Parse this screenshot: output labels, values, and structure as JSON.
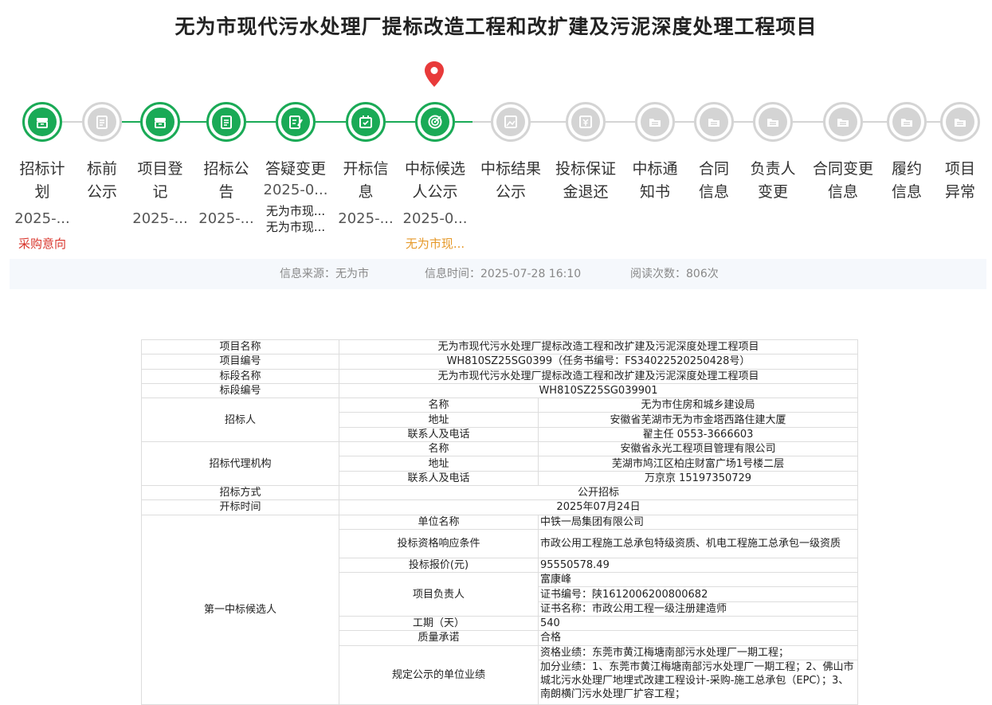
{
  "page_title": "无为市现代污水处理厂提标改造工程和改扩建及污泥深度处理工程项目",
  "colors": {
    "done": "#1aaa56",
    "pending": "#d4d4d4",
    "pin": "#e83a3a",
    "red_note": "#d9342b",
    "orange_note": "#e69a2b"
  },
  "steps": [
    {
      "l1": "招标计",
      "l2": "划",
      "date": "2025-...",
      "note": "采购意向",
      "state": "done"
    },
    {
      "l1": "标前",
      "l2": "公示",
      "state": "pending"
    },
    {
      "l1": "项目登",
      "l2": "记",
      "date": "2025-...",
      "state": "done"
    },
    {
      "l1": "招标公",
      "l2": "告",
      "date": "2025-...",
      "state": "done"
    },
    {
      "l1": "答疑变更",
      "l2": "",
      "date": "2025-0...",
      "sub1": "无为市现...",
      "sub2": "无为市现...",
      "state": "done"
    },
    {
      "l1": "开标信",
      "l2": "息",
      "date": "2025-...",
      "state": "done"
    },
    {
      "l1": "中标候选",
      "l2": "人公示",
      "date": "2025-0...",
      "note": "无为市现...",
      "state": "current"
    },
    {
      "l1": "中标结果",
      "l2": "公示",
      "state": "pending"
    },
    {
      "l1": "投标保证",
      "l2": "金退还",
      "state": "pending"
    },
    {
      "l1": "中标通",
      "l2": "知书",
      "state": "pending"
    },
    {
      "l1": "合同",
      "l2": "信息",
      "state": "pending"
    },
    {
      "l1": "负责人",
      "l2": "变更",
      "state": "pending"
    },
    {
      "l1": "合同变更",
      "l2": "信息",
      "state": "pending"
    },
    {
      "l1": "履约",
      "l2": "信息",
      "state": "pending"
    },
    {
      "l1": "项目",
      "l2": "异常",
      "state": "pending"
    }
  ],
  "info": {
    "source": "信息来源：无为市",
    "time": "信息时间：2025-07-28 16:10",
    "views": "阅读次数：806次"
  },
  "table": {
    "proj_name_k": "项目名称",
    "proj_name_v": "无为市现代污水处理厂提标改造工程和改扩建及污泥深度处理工程项目",
    "proj_no_k": "项目编号",
    "proj_no_v": "WH810SZ25SG0399（任务书编号：FS34022520250428号）",
    "sec_name_k": "标段名称",
    "sec_name_v": "无为市现代污水处理厂提标改造工程和改扩建及污泥深度处理工程项目",
    "sec_no_k": "标段编号",
    "sec_no_v": "WH810SZ25SG039901",
    "tenderer_k": "招标人",
    "name_k": "名称",
    "addr_k": "地址",
    "contact_k": "联系人及电话",
    "tenderer_name": "无为市住房和城乡建设局",
    "tenderer_addr": "安徽省芜湖市无为市金塔西路住建大厦",
    "tenderer_contact": "翟主任 0553-3666603",
    "agent_k": "招标代理机构",
    "agent_name": "安徽省永光工程项目管理有限公司",
    "agent_addr": "芜湖市鸠江区柏庄财富广场1号楼二层",
    "agent_contact": "万京京 15197350729",
    "method_k": "招标方式",
    "method_v": "公开招标",
    "open_k": "开标时间",
    "open_v": "2025年07月24日",
    "cand1_k": "第一中标候选人",
    "unit_k": "单位名称",
    "unit_v": "中铁一局集团有限公司",
    "qual_k": "投标资格响应条件",
    "qual_v": "市政公用工程施工总承包特级资质、机电工程施工总承包一级资质",
    "price_k": "投标报价(元)",
    "price_v": "95550578.49",
    "pm_k": "项目负责人",
    "pm_name": "富康峰",
    "pm_cert_no": "证书编号：陕1612006200800682",
    "pm_cert_name": "证书名称：市政公用工程一级注册建造师",
    "period_k": "工期（天）",
    "period_v": "540",
    "quality_k": "质量承诺",
    "quality_v": "合格",
    "perf_k": "规定公示的单位业绩",
    "perf_v1": "资格业绩：东莞市黄江梅塘南部污水处理厂一期工程；",
    "perf_v2": "加分业绩：1、东莞市黄江梅塘南部污水处理厂一期工程；2、佛山市城北污水处理厂地埋式改建工程设计-采购-施工总承包（EPC）；3、南朗横门污水处理厂扩容工程；"
  }
}
